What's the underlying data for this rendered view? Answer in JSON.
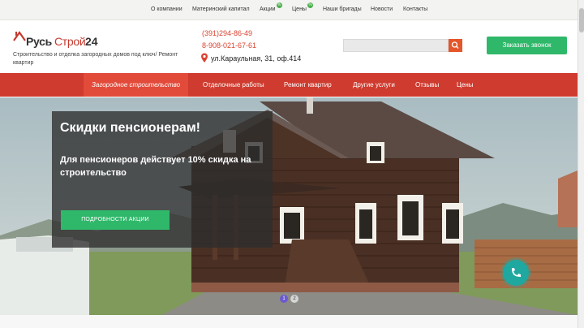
{
  "topnav": {
    "items": [
      {
        "label": "О компании"
      },
      {
        "label": "Материнский капитал"
      },
      {
        "label": "Акции",
        "badge": "%"
      },
      {
        "label": "Цены",
        "badge": "%"
      },
      {
        "label": "Наши бригады"
      },
      {
        "label": "Новости"
      },
      {
        "label": "Контакты"
      }
    ]
  },
  "header": {
    "logo": {
      "part1": "Русь",
      "part2": "Строй",
      "part3": "24"
    },
    "tagline": "Строительство и отделка загородных домов под ключ/ Ремонт квартир",
    "phone1": "(391)294-86-49",
    "phone2": "8-908-021-67-61",
    "address": "ул.Караульная, 31, оф.414",
    "search_placeholder": "",
    "call_button": "Заказать звонок"
  },
  "menu": {
    "items": [
      {
        "label": "Загородное строительство"
      },
      {
        "label": "Отделочные работы"
      },
      {
        "label": "Ремонт квартир"
      },
      {
        "label": "Другие услуги"
      },
      {
        "label": "Отзывы"
      },
      {
        "label": "Цены"
      }
    ]
  },
  "hero": {
    "title": "Скидки пенсионерам!",
    "text": "Для пенсионеров действует 10% скидка на строительство",
    "button": "ПОДРОБНОСТИ АКЦИИ",
    "slides": [
      "1",
      "2"
    ]
  },
  "colors": {
    "accent_red": "#cf3b2f",
    "accent_green": "#2fb86a",
    "fab": "#1fa8a0"
  },
  "icons": [
    "logo-roof-icon",
    "percent-icon",
    "map-pin-icon",
    "search-icon",
    "phone-icon"
  ]
}
